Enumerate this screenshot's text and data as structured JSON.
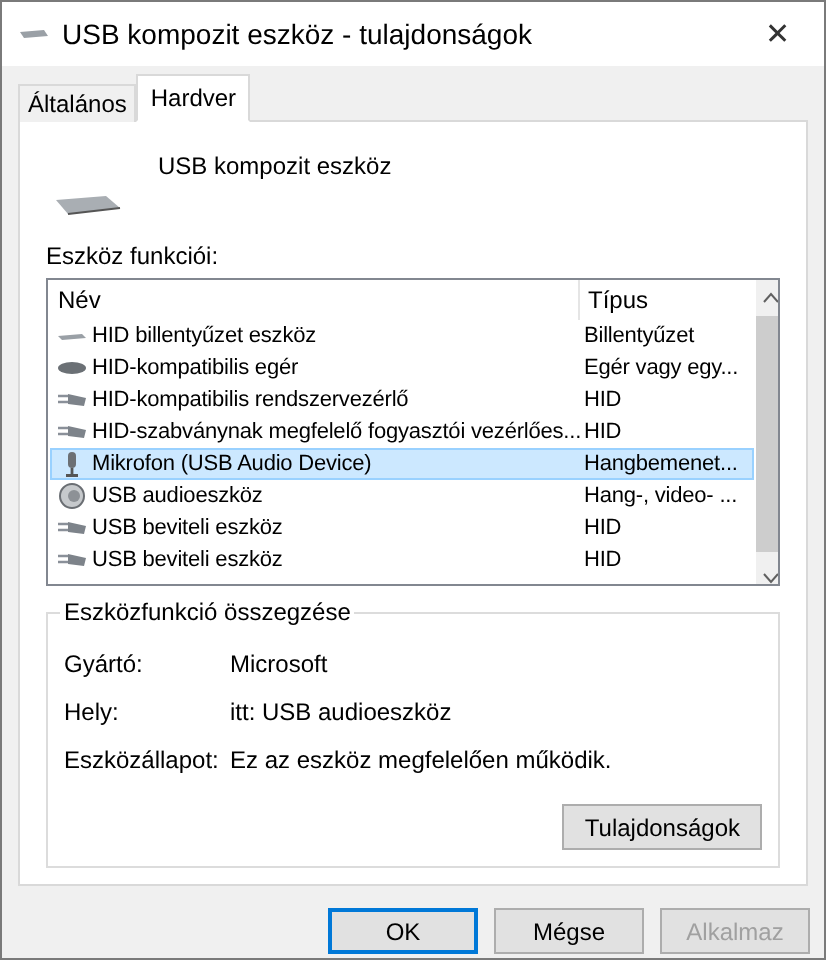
{
  "window": {
    "title": "USB kompozit eszköz - tulajdonságok",
    "close": "✕"
  },
  "tabs": [
    {
      "label": "Általános",
      "selected": false
    },
    {
      "label": "Hardver",
      "selected": true
    }
  ],
  "device": {
    "name": "USB kompozit eszköz"
  },
  "functions": {
    "label": "Eszköz funkciói:",
    "columns": [
      "Név",
      "Típus"
    ],
    "rows": [
      {
        "kind": "keyboard",
        "name": "HID billentyűzet eszköz",
        "type": "Billentyűzet",
        "selected": false
      },
      {
        "kind": "mouse",
        "name": "HID-kompatibilis egér",
        "type": "Egér vagy egy...",
        "selected": false
      },
      {
        "kind": "hid",
        "name": "HID-kompatibilis rendszervezérlő",
        "type": "HID",
        "selected": false
      },
      {
        "kind": "hid",
        "name": "HID-szabványnak megfelelő fogyasztói vezérlőes...",
        "type": "HID",
        "selected": false
      },
      {
        "kind": "microphone",
        "name": "Mikrofon (USB Audio Device)",
        "type": "Hangbemenet...",
        "selected": true
      },
      {
        "kind": "speaker",
        "name": "USB audioeszköz",
        "type": "Hang-, video- ...",
        "selected": false
      },
      {
        "kind": "hid",
        "name": "USB beviteli eszköz",
        "type": "HID",
        "selected": false
      },
      {
        "kind": "hid",
        "name": "USB beviteli eszköz",
        "type": "HID",
        "selected": false
      }
    ]
  },
  "summary": {
    "title": "Eszközfunkció összegzése",
    "fields": [
      {
        "label": "Gyártó:",
        "value": "Microsoft"
      },
      {
        "label": "Hely:",
        "value": "itt: USB audioeszköz"
      },
      {
        "label": "Eszközállapot:",
        "value": "Ez az eszköz megfelelően működik."
      }
    ],
    "button": "Tulajdonságok"
  },
  "buttons": [
    {
      "label": "OK",
      "kind": "default",
      "disabled": false
    },
    {
      "label": "Mégse",
      "kind": "normal",
      "disabled": false
    },
    {
      "label": "Alkalmaz",
      "kind": "normal",
      "disabled": true
    }
  ]
}
